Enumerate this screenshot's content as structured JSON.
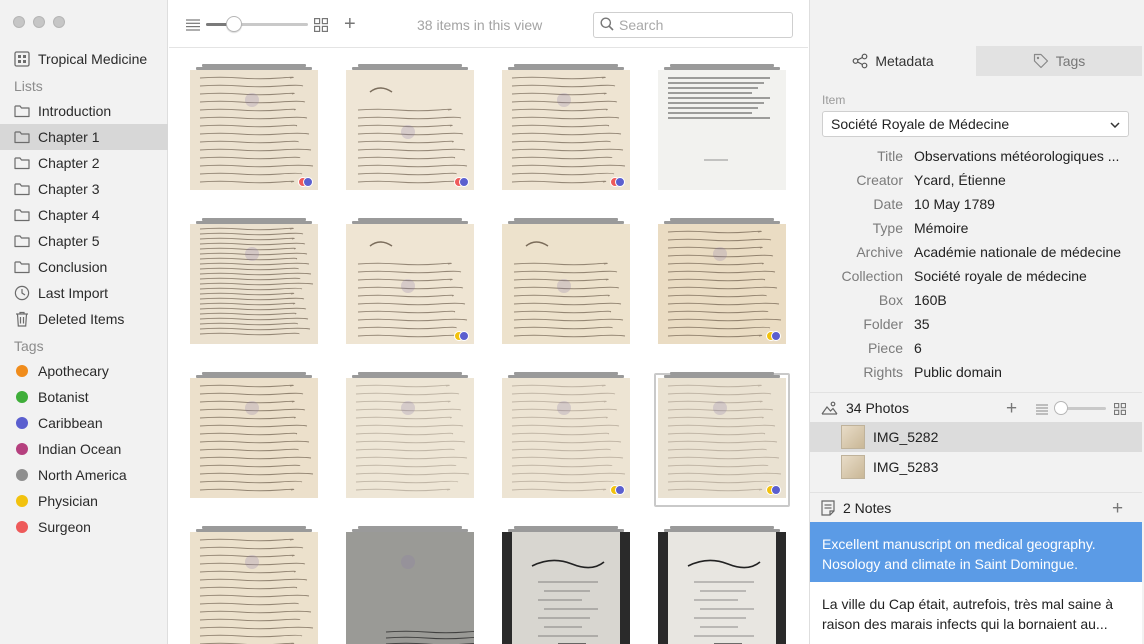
{
  "window": {
    "title": "Tropical Medicine"
  },
  "sidebar": {
    "project": "Tropical Medicine",
    "lists_header": "Lists",
    "lists": [
      {
        "label": "Introduction",
        "icon": "folder-icon"
      },
      {
        "label": "Chapter 1",
        "icon": "folder-icon",
        "selected": true
      },
      {
        "label": "Chapter 2",
        "icon": "folder-icon"
      },
      {
        "label": "Chapter 3",
        "icon": "folder-icon"
      },
      {
        "label": "Chapter 4",
        "icon": "folder-icon"
      },
      {
        "label": "Chapter 5",
        "icon": "folder-icon"
      },
      {
        "label": "Conclusion",
        "icon": "folder-icon"
      },
      {
        "label": "Last Import",
        "icon": "clock-icon"
      },
      {
        "label": "Deleted Items",
        "icon": "trash-icon"
      }
    ],
    "tags_header": "Tags",
    "tags": [
      {
        "label": "Apothecary",
        "color": "#f08c1c"
      },
      {
        "label": "Botanist",
        "color": "#3fae3a"
      },
      {
        "label": "Caribbean",
        "color": "#5b5fcf"
      },
      {
        "label": "Indian Ocean",
        "color": "#b5407e"
      },
      {
        "label": "North America",
        "color": "#8f8f8f"
      },
      {
        "label": "Physician",
        "color": "#f2c20e"
      },
      {
        "label": "Surgeon",
        "color": "#ee5a5a"
      }
    ]
  },
  "toolbar": {
    "item_count": "38 items in this view",
    "search_placeholder": "Search",
    "zoom_level": 0.27
  },
  "grid": {
    "items": [
      {
        "style": "script",
        "tone": "#ece2d0",
        "badges": [
          "#ee5a5a",
          "#5b5fcf"
        ]
      },
      {
        "style": "letter",
        "tone": "#efe6d6",
        "badges": [
          "#ee5a5a",
          "#5b5fcf"
        ]
      },
      {
        "style": "script",
        "tone": "#eee4d2",
        "badges": [
          "#ee5a5a",
          "#5b5fcf"
        ]
      },
      {
        "style": "typed",
        "tone": "#f2f2ef",
        "badges": []
      },
      {
        "style": "dense",
        "tone": "#ebe1cf",
        "badges": []
      },
      {
        "style": "letter",
        "tone": "#efe5d3",
        "badges": [
          "#f2c20e",
          "#5b5fcf"
        ]
      },
      {
        "style": "letter",
        "tone": "#ede2cc",
        "badges": []
      },
      {
        "style": "script",
        "tone": "#eadcc3",
        "badges": [
          "#f2c20e",
          "#5b5fcf"
        ]
      },
      {
        "style": "script",
        "tone": "#ece0cb",
        "badges": []
      },
      {
        "style": "faint",
        "tone": "#eee6d6",
        "badges": []
      },
      {
        "style": "faint",
        "tone": "#ede4d3",
        "badges": [
          "#f2c20e",
          "#5b5fcf"
        ]
      },
      {
        "style": "faint",
        "tone": "#eae2d2",
        "badges": [
          "#f2c20e",
          "#5b5fcf"
        ],
        "selected": true
      },
      {
        "style": "script",
        "tone": "#ece1cc",
        "badges": []
      },
      {
        "style": "grey",
        "tone": "#9a9a96",
        "badges": []
      },
      {
        "style": "cover",
        "tone": "#d8d6d0",
        "badges": []
      },
      {
        "style": "cover",
        "tone": "#e8e6e1",
        "badges": []
      }
    ]
  },
  "panel": {
    "tab_metadata": "Metadata",
    "tab_tags": "Tags",
    "item_label": "Item",
    "item_value": "Société Royale de Médecine",
    "fields": [
      {
        "key": "Title",
        "value": "Observations météorologiques ..."
      },
      {
        "key": "Creator",
        "value": "Ycard, Étienne"
      },
      {
        "key": "Date",
        "value": "10 May 1789"
      },
      {
        "key": "Type",
        "value": "Mémoire"
      },
      {
        "key": "Archive",
        "value": "Académie nationale de médecine"
      },
      {
        "key": "Collection",
        "value": "Société royale de médecine"
      },
      {
        "key": "Box",
        "value": "160B"
      },
      {
        "key": "Folder",
        "value": "35"
      },
      {
        "key": "Piece",
        "value": "6"
      },
      {
        "key": "Rights",
        "value": "Public domain"
      }
    ],
    "photos_label": "34 Photos",
    "photos": [
      {
        "name": "IMG_5282",
        "selected": true
      },
      {
        "name": "IMG_5283"
      }
    ],
    "notes_label": "2 Notes",
    "notes": [
      {
        "text": "Excellent manuscript on medical geography. Nosology and climate in Saint Domingue.",
        "selected": true
      },
      {
        "text": "La ville du Cap était, autrefois, très mal saine à raison des marais infects qui la bornaient au..."
      }
    ]
  }
}
